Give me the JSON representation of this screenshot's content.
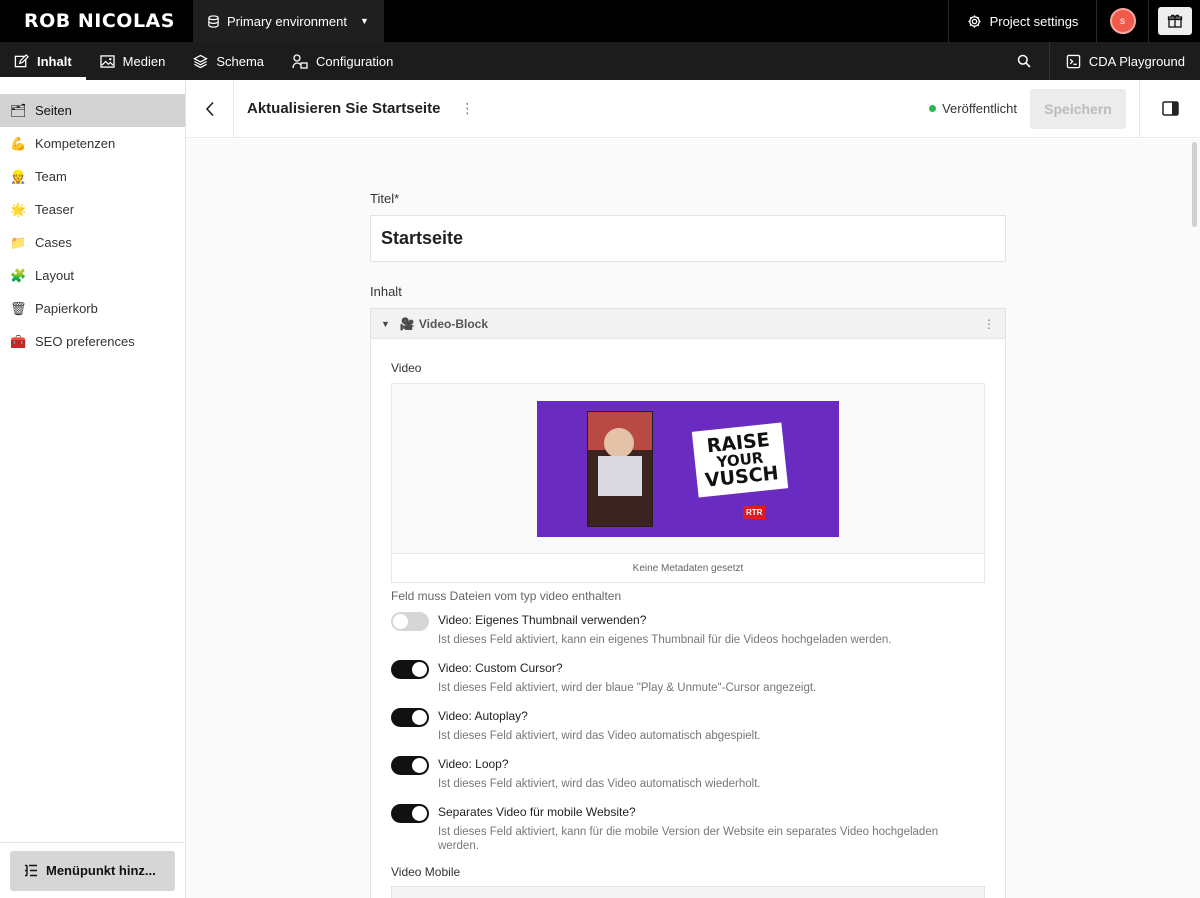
{
  "topbar": {
    "brand": "ROB NICOLAS",
    "environment": "Primary environment",
    "project_settings": "Project settings",
    "avatar_initial": "s",
    "icons": [
      "database-icon",
      "chevron-down-icon",
      "gear-icon",
      "gift-icon"
    ]
  },
  "nav": {
    "tabs": [
      {
        "label": "Inhalt",
        "icon": "edit-icon",
        "active": true
      },
      {
        "label": "Medien",
        "icon": "image-icon"
      },
      {
        "label": "Schema",
        "icon": "layers-icon"
      },
      {
        "label": "Configuration",
        "icon": "config-icon"
      }
    ],
    "cda_playground": "CDA Playground"
  },
  "sidebar": {
    "items": [
      {
        "label": "Seiten",
        "emoji": "🗂",
        "active": true
      },
      {
        "label": "Kompetenzen",
        "emoji": "💪"
      },
      {
        "label": "Team",
        "emoji": "👷"
      },
      {
        "label": "Teaser",
        "emoji": "🌟"
      },
      {
        "label": "Cases",
        "emoji": "📁"
      },
      {
        "label": "Layout",
        "emoji": "🧩"
      },
      {
        "label": "Papierkorb",
        "emoji": "🗑"
      },
      {
        "label": "SEO preferences",
        "emoji": "🧰"
      }
    ],
    "add_menu_button": "Menüpunkt hinz..."
  },
  "header": {
    "title": "Aktualisieren Sie Startseite",
    "status": "Veröffentlicht",
    "status_color": "#2db84d",
    "save_label": "Speichern"
  },
  "form": {
    "title_label": "Titel*",
    "title_value": "Startseite",
    "content_label": "Inhalt",
    "block": {
      "emoji": "🎥",
      "name": "Video-Block",
      "video_label": "Video",
      "thumbnail": {
        "text_lines": [
          "RAISE",
          "YOUR",
          "VUSCH"
        ],
        "logo": "RTR",
        "bg_color": "#6a2bc1"
      },
      "media_footer": "Keine Metadaten gesetzt",
      "hint": "Feld muss Dateien vom typ video enthalten",
      "toggles": [
        {
          "label": "Video: Eigenes Thumbnail verwenden?",
          "description": "Ist dieses Feld aktiviert, kann ein eigenes Thumbnail für die Videos hochgeladen werden.",
          "on": false
        },
        {
          "label": "Video: Custom Cursor?",
          "description": "Ist dieses Feld aktiviert, wird der blaue \"Play & Unmute\"-Cursor angezeigt.",
          "on": true
        },
        {
          "label": "Video: Autoplay?",
          "description": "Ist dieses Feld aktiviert, wird das Video automatisch abgespielt.",
          "on": true
        },
        {
          "label": "Video: Loop?",
          "description": "Ist dieses Feld aktiviert, wird das Video automatisch wiederholt.",
          "on": true
        },
        {
          "label": "Separates Video für mobile Website?",
          "description": "Ist dieses Feld aktiviert, kann für die mobile Version der Website ein separates Video hochgeladen werden.",
          "on": true
        }
      ],
      "video_mobile_label": "Video Mobile"
    }
  }
}
